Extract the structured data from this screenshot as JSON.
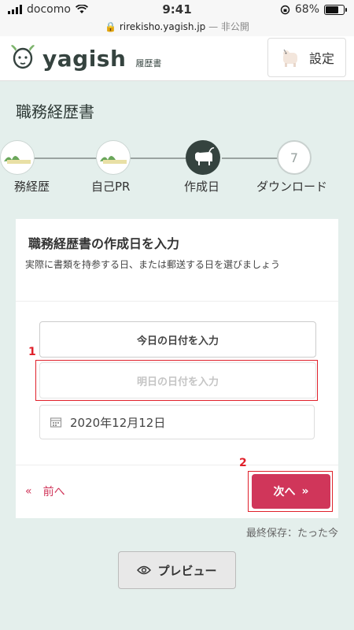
{
  "status_bar": {
    "carrier": "docomo",
    "time": "9:41",
    "battery": "68%",
    "url": "rirekisho.yagish.jp",
    "url_suffix": "— 非公開"
  },
  "header": {
    "logo_text": "yagish",
    "logo_sub": "履歴書",
    "settings_label": "設定"
  },
  "page": {
    "title": "職務経歴書"
  },
  "stepper": {
    "steps": [
      {
        "label": "務経歴",
        "state": "done"
      },
      {
        "label": "自己PR",
        "state": "done"
      },
      {
        "label": "作成日",
        "state": "active"
      },
      {
        "label": "ダウンロード",
        "state": "todo",
        "number": "7"
      }
    ]
  },
  "form": {
    "title": "職務経歴書の作成日を入力",
    "description": "実際に書類を持参する日、または郵送する日を選びましょう",
    "today_button": "今日の日付を入力",
    "tomorrow_button": "明日の日付を入力",
    "date_value": "2020年12月12日",
    "prev_label": "前へ",
    "next_label": "次へ"
  },
  "annotations": {
    "one": "1",
    "two": "2"
  },
  "footer": {
    "save_status": "最終保存：たった今",
    "preview_label": "プレビュー"
  },
  "colors": {
    "accent": "#d0365a",
    "brand_dark": "#35433f",
    "background": "#e4efec",
    "annotation": "#e0202a"
  }
}
